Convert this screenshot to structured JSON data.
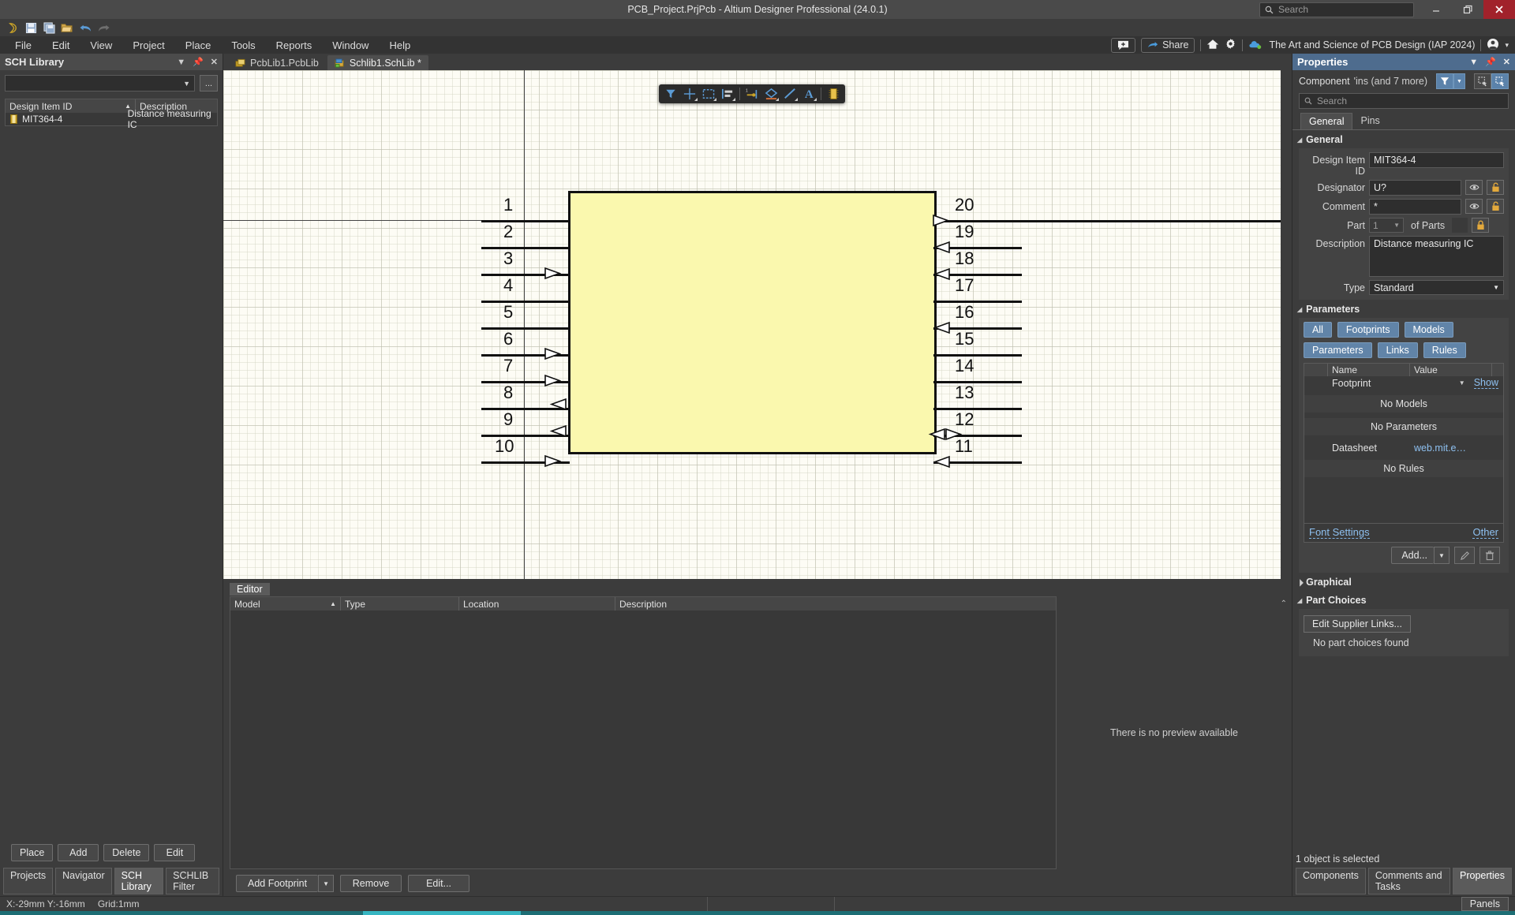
{
  "titlebar": {
    "title": "PCB_Project.PrjPcb - Altium Designer Professional (24.0.1)",
    "search_placeholder": "Search",
    "minimize": "–",
    "restore": "❐",
    "close": "✕"
  },
  "quick_toolbar": [
    {
      "name": "altium-logo-icon",
      "glyph": "∂"
    },
    {
      "name": "save-icon",
      "glyph": "▤"
    },
    {
      "name": "save-all-icon",
      "glyph": "▤"
    },
    {
      "name": "open-project-icon",
      "glyph": "📂"
    },
    {
      "name": "undo-icon",
      "glyph": "↩"
    },
    {
      "name": "redo-icon",
      "glyph": "↪"
    }
  ],
  "menubar": {
    "items": [
      "File",
      "Edit",
      "View",
      "Project",
      "Place",
      "Tools",
      "Reports",
      "Window",
      "Help"
    ],
    "right": {
      "notifications_icon": "comment-plus-icon",
      "share_label": "Share",
      "home_icon": "home-icon",
      "settings_icon": "gear-icon",
      "workspace_icon": "cloud-icon",
      "workspace_name": "The Art and Science of PCB Design (IAP 2024)",
      "account_icon": "account-icon",
      "account_caret": "▾"
    }
  },
  "sch_library": {
    "title": "SCH Library",
    "header_icons": [
      "chevron-down-icon",
      "pin-icon",
      "close-icon"
    ],
    "library_select_value": "",
    "ellipsis_button": "...",
    "columns": [
      "Design Item ID",
      "Description"
    ],
    "rows": [
      {
        "id": "MIT364-4",
        "description": "Distance measuring IC"
      }
    ],
    "buttons": [
      "Place",
      "Add",
      "Delete",
      "Edit"
    ],
    "bottom_tabs": [
      "Projects",
      "Navigator",
      "SCH Library",
      "SCHLIB Filter"
    ],
    "active_bottom_tab": "SCH Library"
  },
  "document_tabs": [
    {
      "label": "PcbLib1.PcbLib",
      "icon": "pcblib-icon",
      "active": false
    },
    {
      "label": "Schlib1.SchLib *",
      "icon": "schlib-icon",
      "active": true
    }
  ],
  "canvas_toolbar": [
    {
      "name": "filter-icon",
      "glyph": "▼"
    },
    {
      "name": "crosshair-icon",
      "glyph": "+"
    },
    {
      "name": "select-area-icon",
      "glyph": "▢"
    },
    {
      "name": "align-icon",
      "glyph": "▤"
    },
    {
      "name": "place-pin-icon",
      "glyph": "⊶"
    },
    {
      "name": "place-polygon-icon",
      "glyph": "◇"
    },
    {
      "name": "place-line-icon",
      "glyph": "╱"
    },
    {
      "name": "place-text-icon",
      "glyph": "A"
    },
    {
      "name": "place-component-icon",
      "glyph": "▮"
    }
  ],
  "schematic": {
    "component_fill": "#faf8ae",
    "component_outline": "#111111",
    "left_pins": [
      {
        "number": "1",
        "has_arrow": false
      },
      {
        "number": "2",
        "has_arrow": false
      },
      {
        "number": "3",
        "has_arrow": true,
        "dir": "in"
      },
      {
        "number": "4",
        "has_arrow": false
      },
      {
        "number": "5",
        "has_arrow": false
      },
      {
        "number": "6",
        "has_arrow": true,
        "dir": "in"
      },
      {
        "number": "7",
        "has_arrow": true,
        "dir": "in"
      },
      {
        "number": "8",
        "has_arrow": true,
        "dir": "out"
      },
      {
        "number": "9",
        "has_arrow": true,
        "dir": "out"
      },
      {
        "number": "10",
        "has_arrow": true,
        "dir": "in"
      }
    ],
    "right_pins": [
      {
        "number": "20",
        "has_arrow": true,
        "dir": "out"
      },
      {
        "number": "19",
        "has_arrow": true,
        "dir": "in"
      },
      {
        "number": "18",
        "has_arrow": true,
        "dir": "in"
      },
      {
        "number": "17",
        "has_arrow": false
      },
      {
        "number": "16",
        "has_arrow": true,
        "dir": "in"
      },
      {
        "number": "15",
        "has_arrow": false
      },
      {
        "number": "14",
        "has_arrow": false
      },
      {
        "number": "13",
        "has_arrow": false
      },
      {
        "number": "12",
        "has_arrow": true,
        "dir": "bidir"
      },
      {
        "number": "11",
        "has_arrow": true,
        "dir": "in"
      }
    ]
  },
  "editor_tab": "Editor",
  "model_panel": {
    "columns": [
      "Model",
      "Type",
      "Location",
      "Description"
    ],
    "rows": [],
    "preview_text": "There is no preview available",
    "buttons": {
      "add_footprint": "Add Footprint",
      "add_footprint_caret": "▼",
      "remove": "Remove",
      "edit": "Edit..."
    }
  },
  "properties": {
    "title": "Properties",
    "header_icons": [
      "chevron-down-icon",
      "pin-icon",
      "close-icon"
    ],
    "object_type": "Component",
    "object_sub": "'ins (and 7 more)",
    "filter_icon": "funnel-icon",
    "filter_caret": "▼",
    "search_placeholder": "Search",
    "tabs": [
      "General",
      "Pins"
    ],
    "active_tab": "General",
    "general": {
      "section_label": "General",
      "fields": [
        {
          "label": "Design Item ID",
          "value": "MIT364-4"
        },
        {
          "label": "Designator",
          "value": "U?"
        },
        {
          "label": "Comment",
          "value": "*"
        },
        {
          "label": "Part",
          "value": "1"
        },
        {
          "label": "Description",
          "value": "Distance measuring IC"
        },
        {
          "label": "Type",
          "value": "Standard"
        }
      ],
      "of_parts_label": "of Parts",
      "of_parts_value": ""
    },
    "parameters": {
      "section_label": "Parameters",
      "chips_row1": [
        "All",
        "Footprints",
        "Models"
      ],
      "chips_row2": [
        "Parameters",
        "Links",
        "Rules"
      ],
      "columns": [
        "Name",
        "Value"
      ],
      "rows": [
        {
          "name": "Footprint",
          "value": "",
          "action": "Show"
        },
        {
          "empty": "No Models"
        },
        {
          "empty": "No Parameters"
        },
        {
          "name": "Datasheet",
          "value": "web.mit.e…"
        },
        {
          "empty": "No Rules"
        }
      ],
      "font_settings": "Font Settings",
      "other": "Other",
      "add_label": "Add...",
      "add_caret": "▼",
      "edit_icon": "pencil-icon",
      "delete_icon": "trash-icon"
    },
    "graphical": {
      "section_label": "Graphical"
    },
    "part_choices": {
      "section_label": "Part Choices",
      "edit_supplier_links": "Edit Supplier Links...",
      "no_choices": "No part choices found"
    },
    "selection_status": "1 object is selected",
    "bottom_tabs": [
      "Components",
      "Comments and Tasks",
      "Properties"
    ],
    "active_bottom_tab": "Properties"
  },
  "statusbar": {
    "coords_x": "X:-29mm Y:-16mm",
    "grid": "Grid:1mm",
    "panels_button": "Panels"
  }
}
